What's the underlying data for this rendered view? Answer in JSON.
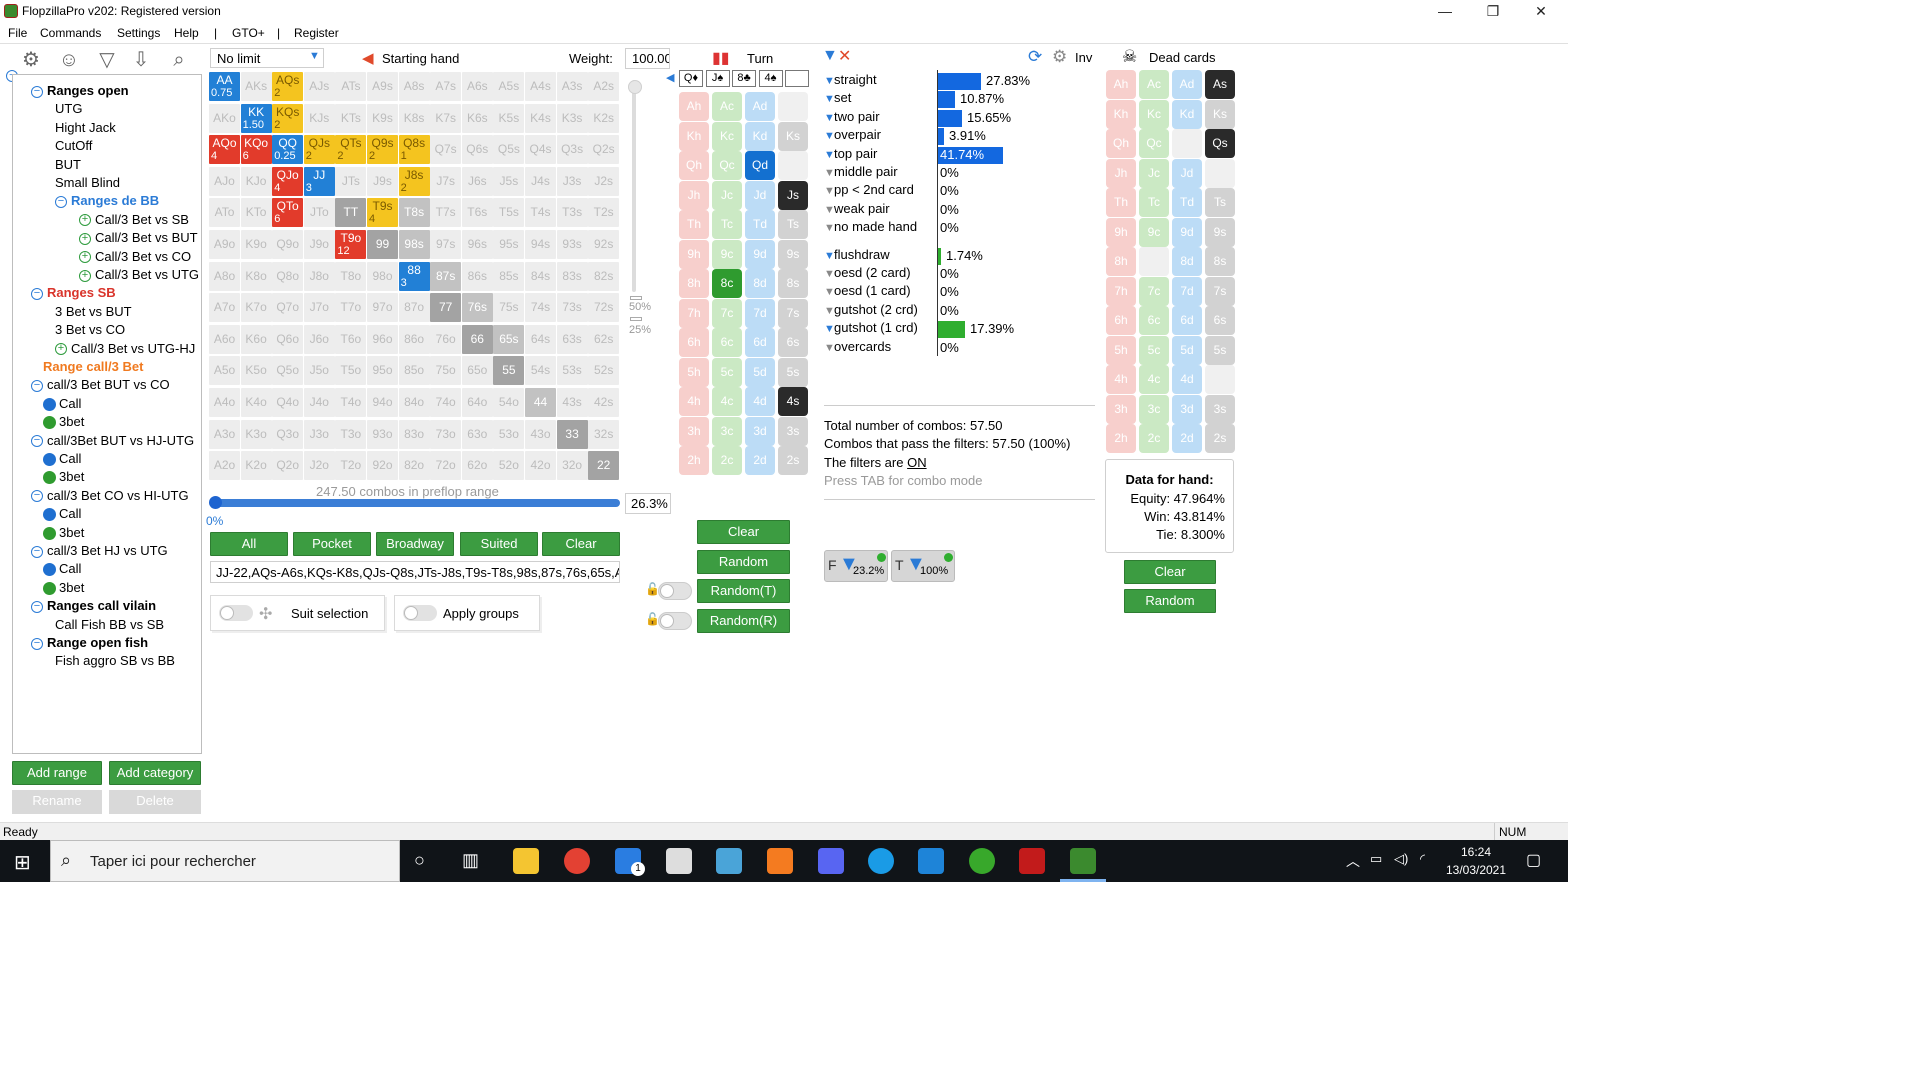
{
  "window": {
    "title": "FlopzillaPro v202: Registered version",
    "minimize": "—",
    "restore": "❐",
    "close": "✕"
  },
  "menu": {
    "items": [
      "File",
      "Commands",
      "Settings",
      "Help",
      "|",
      "GTO+",
      "|",
      "Register"
    ]
  },
  "tree": {
    "nodes": [
      {
        "label": "Ranges open",
        "style": "bold"
      },
      {
        "label": "UTG"
      },
      {
        "label": "Hight Jack"
      },
      {
        "label": "CutOff"
      },
      {
        "label": "BUT"
      },
      {
        "label": "Small Blind"
      },
      {
        "label": "Ranges de BB",
        "style": "blue"
      },
      {
        "label": "Call/3 Bet vs SB"
      },
      {
        "label": "Call/3 Bet vs BUT"
      },
      {
        "label": "Call/3 Bet vs CO"
      },
      {
        "label": "Call/3 Bet vs UTG"
      },
      {
        "label": "Ranges SB",
        "style": "red"
      },
      {
        "label": "3 Bet vs BUT"
      },
      {
        "label": "3 Bet vs CO"
      },
      {
        "label": "Call/3 Bet vs UTG-HJ"
      },
      {
        "label": "Range call/3 Bet",
        "style": "orange"
      },
      {
        "label": "call/3 Bet BUT vs CO"
      },
      {
        "label": "Call"
      },
      {
        "label": "3bet"
      },
      {
        "label": "call/3Bet BUT vs HJ-UTG"
      },
      {
        "label": "Call"
      },
      {
        "label": "3bet"
      },
      {
        "label": "call/3 Bet CO vs HI-UTG"
      },
      {
        "label": "Call"
      },
      {
        "label": "3bet"
      },
      {
        "label": "call/3 Bet HJ vs UTG"
      },
      {
        "label": "Call"
      },
      {
        "label": "3bet"
      },
      {
        "label": "Ranges call vilain",
        "style": "bold"
      },
      {
        "label": "Call Fish BB vs SB"
      },
      {
        "label": "Range open fish",
        "style": "bold"
      },
      {
        "label": "Fish aggro SB vs BB"
      }
    ],
    "buttons": {
      "add_range": "Add range",
      "add_category": "Add category",
      "rename": "Rename",
      "delete": "Delete"
    }
  },
  "range_panel": {
    "game_type": "No limit",
    "starting_hand_label": "Starting hand",
    "weight_label": "Weight:",
    "weight_value": "100.00",
    "combos_text": "247.50 combos in preflop range",
    "slider_left": "0%",
    "slider_pct": "26.3%",
    "side_marks": [
      "50%",
      "25%"
    ],
    "buttons": [
      "All",
      "Pocket",
      "Broadway",
      "Suited",
      "Clear"
    ],
    "range_text": "JJ-22,AQs-A6s,KQs-K8s,QJs-Q8s,JTs-J8s,T9s-T8s,98s,87s,76s,65s,A",
    "suit_selection": "Suit selection",
    "apply_groups": "Apply groups",
    "selection_fraction": 0.263
  },
  "matrix": {
    "rows": [
      [
        "AA",
        "AKs",
        "AQs",
        "AJs",
        "ATs",
        "A9s",
        "A8s",
        "A7s",
        "A6s",
        "A5s",
        "A4s",
        "A3s",
        "A2s"
      ],
      [
        "AKo",
        "KK",
        "KQs",
        "KJs",
        "KTs",
        "K9s",
        "K8s",
        "K7s",
        "K6s",
        "K5s",
        "K4s",
        "K3s",
        "K2s"
      ],
      [
        "AQo",
        "KQo",
        "QQ",
        "QJs",
        "QTs",
        "Q9s",
        "Q8s",
        "Q7s",
        "Q6s",
        "Q5s",
        "Q4s",
        "Q3s",
        "Q2s"
      ],
      [
        "AJo",
        "KJo",
        "QJo",
        "JJ",
        "JTs",
        "J9s",
        "J8s",
        "J7s",
        "J6s",
        "J5s",
        "J4s",
        "J3s",
        "J2s"
      ],
      [
        "ATo",
        "KTo",
        "QTo",
        "JTo",
        "TT",
        "T9s",
        "T8s",
        "T7s",
        "T6s",
        "T5s",
        "T4s",
        "T3s",
        "T2s"
      ],
      [
        "A9o",
        "K9o",
        "Q9o",
        "J9o",
        "T9o",
        "99",
        "98s",
        "97s",
        "96s",
        "95s",
        "94s",
        "93s",
        "92s"
      ],
      [
        "A8o",
        "K8o",
        "Q8o",
        "J8o",
        "T8o",
        "98o",
        "88",
        "87s",
        "86s",
        "85s",
        "84s",
        "83s",
        "82s"
      ],
      [
        "A7o",
        "K7o",
        "Q7o",
        "J7o",
        "T7o",
        "97o",
        "87o",
        "77",
        "76s",
        "75s",
        "74s",
        "73s",
        "72s"
      ],
      [
        "A6o",
        "K6o",
        "Q6o",
        "J6o",
        "T6o",
        "96o",
        "86o",
        "76o",
        "66",
        "65s",
        "64s",
        "63s",
        "62s"
      ],
      [
        "A5o",
        "K5o",
        "Q5o",
        "J5o",
        "T5o",
        "95o",
        "85o",
        "75o",
        "65o",
        "55",
        "54s",
        "53s",
        "52s"
      ],
      [
        "A4o",
        "K4o",
        "Q4o",
        "J4o",
        "T4o",
        "94o",
        "84o",
        "74o",
        "64o",
        "54o",
        "44",
        "43s",
        "42s"
      ],
      [
        "A3o",
        "K3o",
        "Q3o",
        "J3o",
        "T3o",
        "93o",
        "83o",
        "73o",
        "63o",
        "53o",
        "43o",
        "33",
        "32s"
      ],
      [
        "A2o",
        "K2o",
        "Q2o",
        "J2o",
        "T2o",
        "92o",
        "82o",
        "72o",
        "62o",
        "52o",
        "42o",
        "32o",
        "22"
      ]
    ],
    "highlights": {
      "AA": {
        "color": "blue",
        "sub": "0.75"
      },
      "KK": {
        "color": "blue",
        "sub": "1.50"
      },
      "QQ": {
        "color": "blue",
        "sub": "0.25"
      },
      "JJ": {
        "color": "blue",
        "sub": "3"
      },
      "88": {
        "color": "blue",
        "sub": "3"
      },
      "AQs": {
        "color": "yellow",
        "sub": "2"
      },
      "KQs": {
        "color": "yellow",
        "sub": "2"
      },
      "QJs": {
        "color": "yellow",
        "sub": "2"
      },
      "QTs": {
        "color": "yellow",
        "sub": "2"
      },
      "Q9s": {
        "color": "yellow",
        "sub": "2"
      },
      "Q8s": {
        "color": "yellow",
        "sub": "1"
      },
      "J8s": {
        "color": "yellow",
        "sub": "2"
      },
      "T9s": {
        "color": "yellow",
        "sub": "4"
      },
      "AQo": {
        "color": "red",
        "sub": "4"
      },
      "KQo": {
        "color": "red",
        "sub": "6"
      },
      "QJo": {
        "color": "red",
        "sub": "4"
      },
      "QTo": {
        "color": "red",
        "sub": "6"
      },
      "T9o": {
        "color": "red",
        "sub": "12"
      },
      "TT": {
        "color": "gray",
        "sub": ""
      },
      "99": {
        "color": "gray",
        "sub": ""
      },
      "77": {
        "color": "gray",
        "sub": ""
      },
      "66": {
        "color": "gray",
        "sub": ""
      },
      "55": {
        "color": "gray",
        "sub": ""
      },
      "44": {
        "color": "lgray",
        "sub": ""
      },
      "33": {
        "color": "gray",
        "sub": ""
      },
      "22": {
        "color": "gray",
        "sub": ""
      },
      "98s": {
        "color": "lgray",
        "sub": ""
      },
      "87s": {
        "color": "lgray",
        "sub": ""
      },
      "76s": {
        "color": "lgray",
        "sub": ""
      },
      "65s": {
        "color": "lgray",
        "sub": ""
      },
      "T8s": {
        "color": "lgray",
        "sub": ""
      }
    }
  },
  "turn_panel": {
    "label": "Turn",
    "suits": [
      "Q♦",
      "J♠",
      "8♣",
      "4♠",
      ""
    ],
    "columns": [
      [
        "Ah",
        "Kh",
        "Qh",
        "Jh",
        "Th",
        "9h",
        "8h",
        "7h",
        "6h",
        "5h",
        "4h",
        "3h",
        "2h"
      ],
      [
        "Ac",
        "Kc",
        "Qc",
        "Jc",
        "Tc",
        "9c",
        "8c",
        "7c",
        "6c",
        "5c",
        "4c",
        "3c",
        "2c"
      ],
      [
        "Ad",
        "Kd",
        "Qd",
        "Jd",
        "Td",
        "9d",
        "8d",
        "7d",
        "6d",
        "5d",
        "4d",
        "3d",
        "2d"
      ],
      [
        "As",
        "Ks",
        "Qs",
        "Js",
        "Ts",
        "9s",
        "8s",
        "7s",
        "6s",
        "5s",
        "4s",
        "3s",
        "2s"
      ]
    ],
    "picked": {
      "Qd": "blue",
      "8c": "green",
      "Js": "dark",
      "4s": "dark"
    },
    "empty": [
      "As",
      "Qs"
    ],
    "buttons": {
      "clear": "Clear",
      "random": "Random",
      "random_t": "Random(T)",
      "random_r": "Random(R)"
    }
  },
  "stats": {
    "inv_label": "Inv",
    "rows": [
      {
        "label": "straight",
        "value": "27.83%",
        "frac": 0.2783,
        "kind": "made"
      },
      {
        "label": "set",
        "value": "10.87%",
        "frac": 0.1087,
        "kind": "made"
      },
      {
        "label": "two pair",
        "value": "15.65%",
        "frac": 0.1565,
        "kind": "made"
      },
      {
        "label": "overpair",
        "value": "3.91%",
        "frac": 0.0391,
        "kind": "made"
      },
      {
        "label": "top pair",
        "value": "41.74%",
        "frac": 0.4174,
        "kind": "made"
      },
      {
        "label": "middle pair",
        "value": "0%",
        "frac": 0,
        "kind": "made"
      },
      {
        "label": "pp < 2nd card",
        "value": "0%",
        "frac": 0,
        "kind": "made"
      },
      {
        "label": "weak pair",
        "value": "0%",
        "frac": 0,
        "kind": "made"
      },
      {
        "label": "no made hand",
        "value": "0%",
        "frac": 0,
        "kind": "made"
      },
      {
        "label": "flushdraw",
        "value": "1.74%",
        "frac": 0.0174,
        "kind": "draw"
      },
      {
        "label": "oesd (2 card)",
        "value": "0%",
        "frac": 0,
        "kind": "draw"
      },
      {
        "label": "oesd (1 card)",
        "value": "0%",
        "frac": 0,
        "kind": "draw"
      },
      {
        "label": "gutshot (2 crd)",
        "value": "0%",
        "frac": 0,
        "kind": "draw"
      },
      {
        "label": "gutshot (1 crd)",
        "value": "17.39%",
        "frac": 0.1739,
        "kind": "draw"
      },
      {
        "label": "overcards",
        "value": "0%",
        "frac": 0,
        "kind": "draw"
      }
    ],
    "total_combos": "Total number of combos: 57.50",
    "pass_filters": "Combos that pass the filters: 57.50 (100%)",
    "filters_state_prefix": "The filters are ",
    "filters_state": "ON",
    "tab_hint": "Press TAB for combo mode",
    "filter_chip_f": "23.2%",
    "filter_chip_t": "100%"
  },
  "dead_cards": {
    "label": "Dead cards",
    "picked": {
      "As": "dark",
      "Qs": "dark"
    },
    "empty": [
      "Qd",
      "Js",
      "8c",
      "4s"
    ],
    "hand_data_title": "Data for hand:",
    "equity": "Equity: 47.964%",
    "win": "Win: 43.814%",
    "tie": "Tie: 8.300%",
    "buttons": {
      "clear": "Clear",
      "random": "Random"
    }
  },
  "statusbar": {
    "left": "Ready",
    "right": "NUM"
  },
  "taskbar": {
    "search_placeholder": "Taper ici pour rechercher",
    "time": "16:24",
    "date": "13/03/2021",
    "mail_badge": "1"
  },
  "colors": {
    "accent_blue": "#1368e0",
    "green": "#3c9c41",
    "red": "#e23b2b",
    "yellow": "#f4c41f"
  }
}
